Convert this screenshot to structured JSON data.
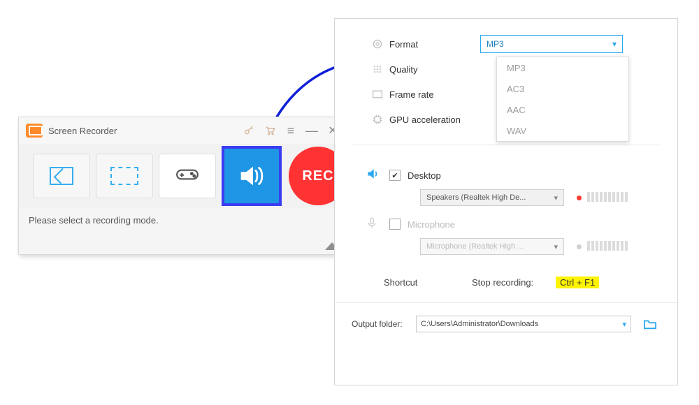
{
  "mini": {
    "title": "Screen Recorder",
    "rec_label": "REC",
    "message": "Please select a recording mode."
  },
  "settings": {
    "format": {
      "label": "Format",
      "value": "MP3",
      "options": [
        "MP3",
        "AC3",
        "AAC",
        "WAV"
      ]
    },
    "quality": {
      "label": "Quality"
    },
    "framerate": {
      "label": "Frame rate"
    },
    "gpu": {
      "label": "GPU acceleration"
    }
  },
  "audio": {
    "desktop": {
      "label": "Desktop",
      "checked": true,
      "device": "Speakers (Realtek High De..."
    },
    "mic": {
      "label": "Microphone",
      "checked": false,
      "device": "Microphone (Realtek High ..."
    }
  },
  "shortcut": {
    "section": "Shortcut",
    "label": "Stop recording:",
    "value": "Ctrl + F1"
  },
  "output": {
    "label": "Output folder:",
    "path": "C:\\Users\\Administrator\\Downloads"
  }
}
